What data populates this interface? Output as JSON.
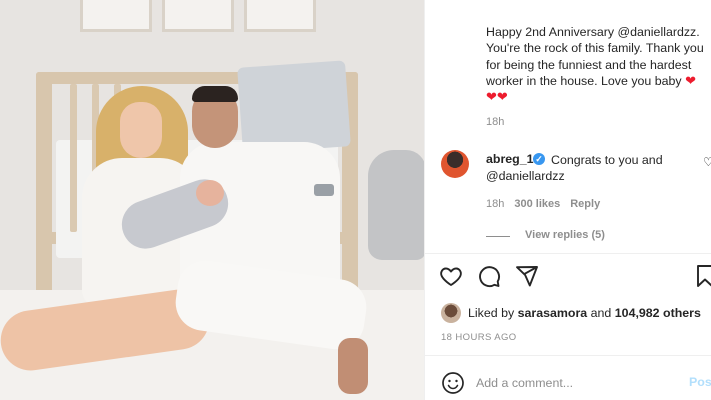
{
  "post": {
    "caption_lines": [
      "Happy 2nd Anniversary @daniellardzz.",
      "You're the rock of this family. Thank you",
      "for being the funniest and the hardest",
      "worker in the house. Love you baby"
    ],
    "caption_time": "18h"
  },
  "comment": {
    "username": "abreg_1",
    "verified_mark": "✓",
    "text_line1": "Congrats to you and",
    "text_line2": "@daniellardzz",
    "time": "18h",
    "likes": "300 likes",
    "reply": "Reply",
    "view_replies": "View replies (5)"
  },
  "likes": {
    "liked_by_prefix": "Liked by ",
    "liked_by_user": "sarasamora",
    "and": " and ",
    "count": "104,982 others"
  },
  "time_ago": "18 HOURS AGO",
  "add_comment": {
    "placeholder": "Add a comment...",
    "post_label": "Post"
  },
  "icons": {
    "like": "heart-icon",
    "comment": "comment-icon",
    "share": "share-icon",
    "save": "bookmark-icon",
    "emoji": "emoji-icon"
  },
  "colors": {
    "heart_red": "#ed1c2e",
    "verified_blue": "#3897f0",
    "post_button_disabled": "#b2dffc",
    "meta_gray": "#8e8e8e"
  }
}
